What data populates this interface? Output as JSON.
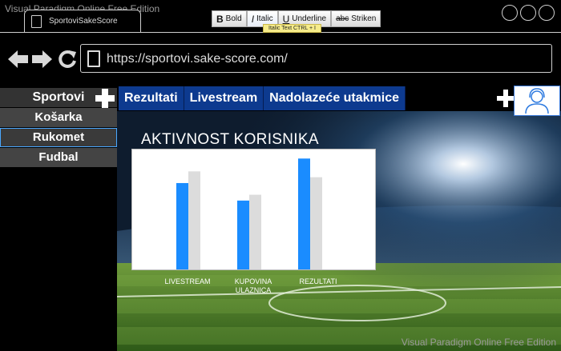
{
  "watermark": "Visual Paradigm Online Free Edition",
  "browser": {
    "tab_title": "SportoviSakeScore",
    "url": "https://sportovi.sake-score.com/"
  },
  "format_toolbar": {
    "bold": {
      "glyph": "B",
      "label": "Bold"
    },
    "italic": {
      "glyph": "I",
      "label": "Italic"
    },
    "underline": {
      "glyph": "U",
      "label": "Underline"
    },
    "strike": {
      "glyph": "abc",
      "label": "Striken"
    },
    "tooltip": "Italic Text CTRL + I"
  },
  "sidebar": {
    "header": "Sportovi",
    "items": [
      {
        "label": "Košarka"
      },
      {
        "label": "Rukomet"
      },
      {
        "label": "Fudbal"
      }
    ],
    "selected": "Rukomet"
  },
  "tabs": [
    {
      "label": "Rezultati"
    },
    {
      "label": "Livestream"
    },
    {
      "label": "Nadolazeće utakmice"
    }
  ],
  "colors": {
    "nav_blue": "#0d3a8f",
    "series_primary": "#1a8cff",
    "series_secondary": "#dcdcdc"
  },
  "chart_data": {
    "type": "bar",
    "title": "AKTIVNOST KORISNIKA",
    "categories": [
      "LIVESTREAM",
      "KUPOVINA ULAZNICA",
      "REZULTATI"
    ],
    "category_lines": [
      [
        "LIVESTREAM"
      ],
      [
        "KUPOVINA",
        "ULAZNICA"
      ],
      [
        "REZULTATI"
      ]
    ],
    "series": [
      {
        "values": [
          74,
          59,
          95
        ]
      },
      {
        "values": [
          84,
          64,
          79
        ]
      }
    ],
    "ylim": [
      0,
      100
    ],
    "grid": false,
    "legend": "none"
  }
}
